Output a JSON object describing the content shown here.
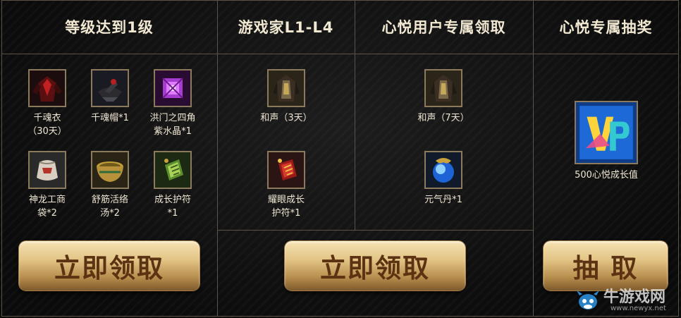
{
  "columns": [
    {
      "title": "等级达到1级"
    },
    {
      "title": "游戏家L1-L4"
    },
    {
      "title": "心悦用户专属领取"
    },
    {
      "title": "心悦专属抽奖"
    }
  ],
  "col1_items": [
    {
      "label": "千魂衣\n（30天）",
      "icon": "dark-robe-icon"
    },
    {
      "label": "千魂帽*1",
      "icon": "dark-hat-icon"
    },
    {
      "label": "洪门之四角\n紫水晶*1",
      "icon": "purple-crystal-icon"
    },
    {
      "label": "神龙工商\n袋*2",
      "icon": "cloth-bag-icon"
    },
    {
      "label": "舒筋活络\n汤*2",
      "icon": "soup-bowl-icon"
    },
    {
      "label": "成长护符\n*1",
      "icon": "green-amulet-icon"
    }
  ],
  "col2_items": [
    {
      "label": "和声（3天）",
      "icon": "dark-robe-icon"
    },
    {
      "label": "耀眼成长\n护符*1",
      "icon": "red-amulet-icon"
    }
  ],
  "col3_items": [
    {
      "label": "和声（7天）",
      "icon": "dark-robe-icon"
    },
    {
      "label": "元气丹*1",
      "icon": "blue-orb-icon"
    }
  ],
  "col4_items": [
    {
      "label": "500心悦成长值",
      "icon": "vip-badge-icon"
    }
  ],
  "buttons": {
    "claim1": "立即领取",
    "claim2": "立即领取",
    "lottery": "抽 取"
  },
  "watermark": {
    "text": "牛游戏网",
    "url": "www.newyx.net"
  },
  "colors": {
    "border": "#5a5346",
    "button_gold": "#e2c486",
    "button_text": "#5b3312"
  }
}
